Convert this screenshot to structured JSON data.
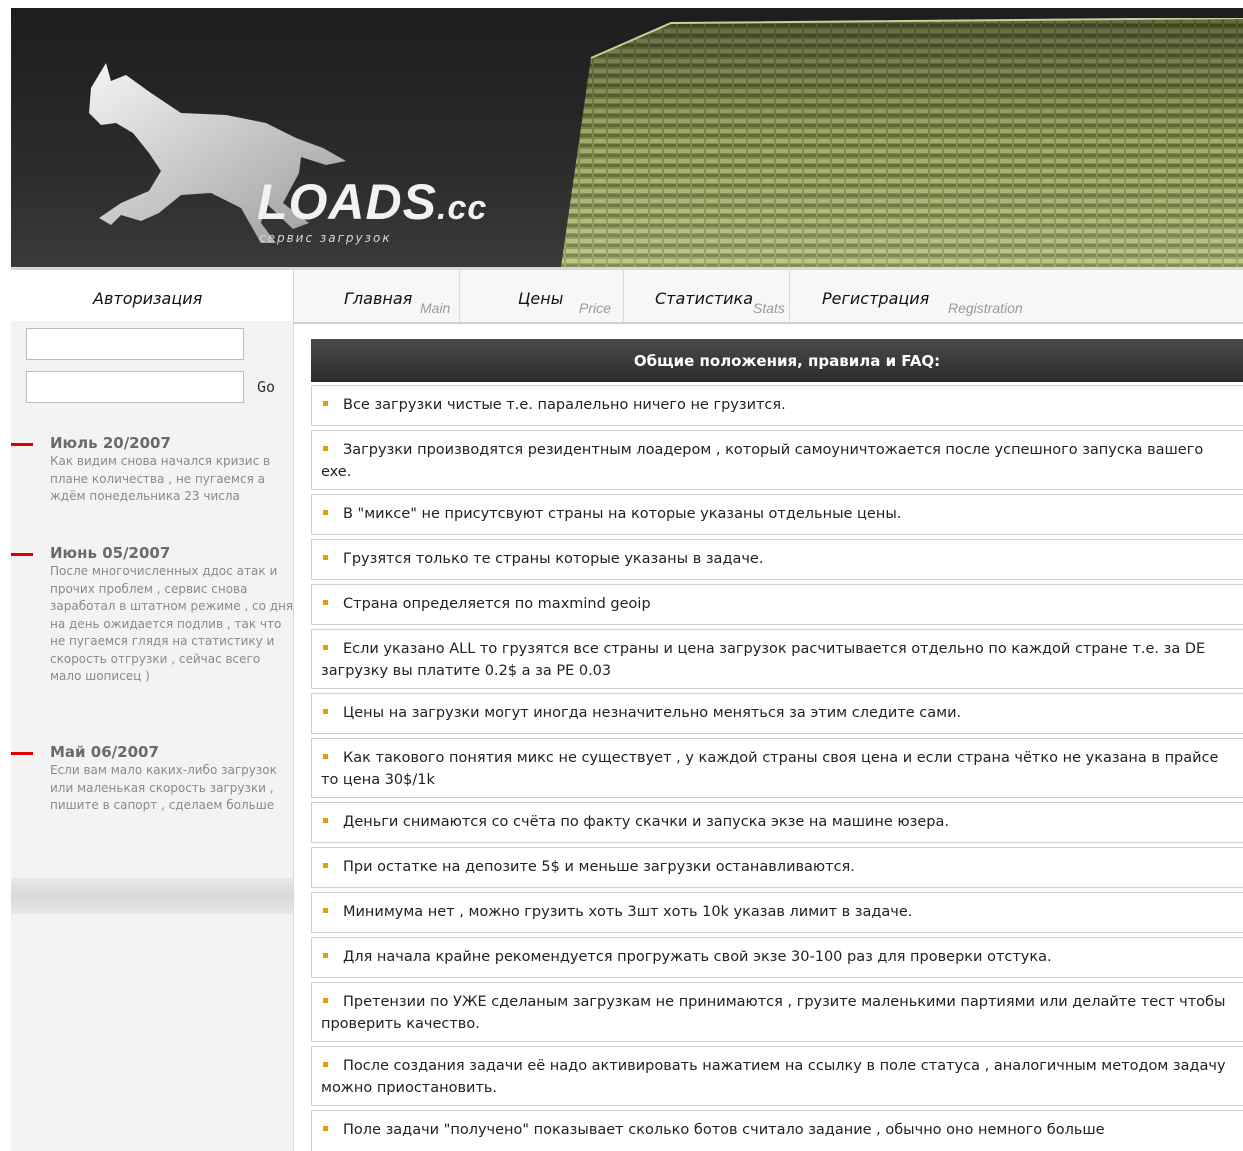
{
  "header": {
    "logo_main": "LOADS",
    "logo_tld": ".cc",
    "logo_sub": "сервис загрузок"
  },
  "nav": {
    "auth_label": "Авторизация",
    "items": [
      {
        "label": "Главная",
        "sub": "Main"
      },
      {
        "label": "Цены",
        "sub": "Price"
      },
      {
        "label": "Статистика",
        "sub": "Stats"
      },
      {
        "label": "Регистрация",
        "sub": "Registration"
      }
    ]
  },
  "login": {
    "username_value": "",
    "password_value": "",
    "go_label": "Go"
  },
  "news": [
    {
      "date": "Июль 20/2007",
      "text": "Как видим снова начался кризис в плане количества , не пугаемся а ждём понедельника 23 числа"
    },
    {
      "date": "Июнь 05/2007",
      "text": "После многочисленных ддос атак и прочих проблем , сервис снова заработал в штатном режиме , со дня на день ожидается подлив , так что не пугаемся глядя на статистику и скорость отгрузки , сейчас всего мало шописец )"
    },
    {
      "date": "Май 06/2007",
      "text": "Если вам мало каких-либо загрузок или маленькая скорость загрузки , пишите в сапорт , сделаем больше"
    }
  ],
  "main": {
    "title": "Общие положения, правила и FAQ:",
    "rules": [
      "Все загрузки чистые т.е. паралельно ничего не грузится.",
      "Загрузки производятся резидентным лоадером , который самоуничтожается после успешного запуска вашего exe.",
      "В \"миксе\" не присутсвуют страны на которые указаны отдельные цены.",
      "Грузятся только те страны которые указаны в задаче.",
      "Страна определяется по maxmind geoip",
      "Если указано ALL то грузятся все страны и цена загрузок расчитывается отдельно по каждой стране т.е. за DE загрузку вы платите 0.2$ а за PE 0.03",
      "Цены на загрузки могут иногда незначительно меняться за этим следите сами.",
      "Как такового понятия микс не существует , у каждой страны своя цена и если страна чётко не указана в прайсе то цена 30$/1k",
      "Деньги снимаются со счёта по факту скачки и запуска экзе на машине юзера.",
      "При остатке на депозите 5$ и меньше загрузки останавливаются.",
      "Минимума нет , можно грузить хоть 3шт хоть 10k указав лимит в задаче.",
      "Для начала крайне рекомендуется прогружать свой экзе 30-100 раз для проверки отстука.",
      "Претензии по УЖЕ сделаным загрузкам не принимаются , грузите маленькими партиями или делайте тест чтобы проверить качество.",
      "После создания задачи её надо активировать нажатием на ссылку в поле статуса , аналогичным методом задачу можно приостановить.",
      "Поле задачи \"получено\" показывает сколько ботов считало задание , обычно оно немного больше"
    ]
  }
}
